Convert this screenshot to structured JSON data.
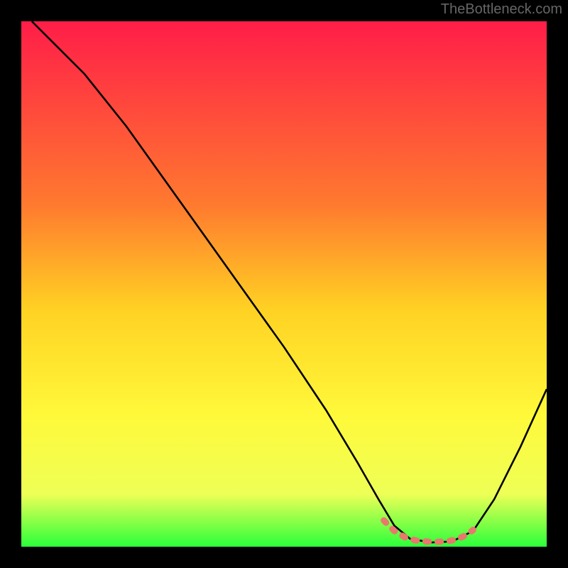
{
  "watermark": "TheBottleneck.com",
  "chart_data": {
    "type": "line",
    "title": "",
    "xlabel": "",
    "ylabel": "",
    "xlim": [
      0,
      100
    ],
    "ylim": [
      0,
      100
    ],
    "grid": false,
    "legend": false,
    "gradient_stops": [
      {
        "offset": 0,
        "color": "#ff1d48"
      },
      {
        "offset": 35,
        "color": "#ff7a2f"
      },
      {
        "offset": 55,
        "color": "#ffd223"
      },
      {
        "offset": 75,
        "color": "#fff93a"
      },
      {
        "offset": 90,
        "color": "#eeff56"
      },
      {
        "offset": 100,
        "color": "#2bff3a"
      }
    ],
    "series": [
      {
        "name": "bottleneck-curve",
        "type": "line",
        "stroke": "#000000",
        "points": [
          {
            "x": 2,
            "y": 100
          },
          {
            "x": 6,
            "y": 96
          },
          {
            "x": 12,
            "y": 90
          },
          {
            "x": 20,
            "y": 80
          },
          {
            "x": 30,
            "y": 66
          },
          {
            "x": 40,
            "y": 52
          },
          {
            "x": 50,
            "y": 38
          },
          {
            "x": 58,
            "y": 26
          },
          {
            "x": 64,
            "y": 16
          },
          {
            "x": 68,
            "y": 9
          },
          {
            "x": 71,
            "y": 4
          },
          {
            "x": 74,
            "y": 1.5
          },
          {
            "x": 78,
            "y": 0.8
          },
          {
            "x": 82,
            "y": 1.0
          },
          {
            "x": 86,
            "y": 3
          },
          {
            "x": 90,
            "y": 9
          },
          {
            "x": 95,
            "y": 19
          },
          {
            "x": 100,
            "y": 30
          }
        ]
      },
      {
        "name": "optimal-zone-highlight",
        "type": "line",
        "stroke": "#e9776e",
        "points": [
          {
            "x": 69,
            "y": 5.0
          },
          {
            "x": 71,
            "y": 3.0
          },
          {
            "x": 73,
            "y": 1.8
          },
          {
            "x": 75,
            "y": 1.2
          },
          {
            "x": 78,
            "y": 0.9
          },
          {
            "x": 81,
            "y": 1.0
          },
          {
            "x": 83,
            "y": 1.4
          },
          {
            "x": 85,
            "y": 2.4
          },
          {
            "x": 86,
            "y": 3.2
          }
        ]
      }
    ]
  }
}
